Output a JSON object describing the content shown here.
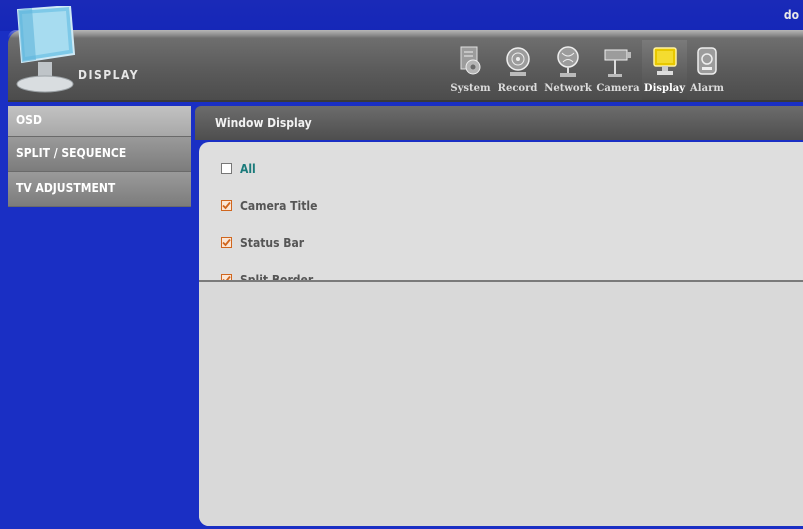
{
  "corner_text": "do",
  "page": {
    "title": "DISPLAY"
  },
  "menu": {
    "items": [
      {
        "label": "System",
        "icon": "system-icon",
        "active": false
      },
      {
        "label": "Record",
        "icon": "record-icon",
        "active": false
      },
      {
        "label": "Network",
        "icon": "network-icon",
        "active": false
      },
      {
        "label": "Camera",
        "icon": "camera-icon",
        "active": false
      },
      {
        "label": "Display",
        "icon": "display-icon",
        "active": true
      },
      {
        "label": "Alarm",
        "icon": "alarm-icon",
        "active": false
      }
    ]
  },
  "sidebar": {
    "items": [
      {
        "label": "OSD",
        "active": true
      },
      {
        "label": "SPLIT / SEQUENCE",
        "active": false
      },
      {
        "label": "TV ADJUSTMENT",
        "active": false
      }
    ]
  },
  "panel": {
    "title": "Window Display",
    "options": [
      {
        "label": "All",
        "checked": false
      },
      {
        "label": "Camera Title",
        "checked": true
      },
      {
        "label": "Status Bar",
        "checked": true
      },
      {
        "label": "Split Border",
        "checked": true
      }
    ]
  },
  "colors": {
    "background": "#1a2fc4",
    "accent_checkbox": "#d0661e",
    "all_label": "#1a7a7a"
  }
}
